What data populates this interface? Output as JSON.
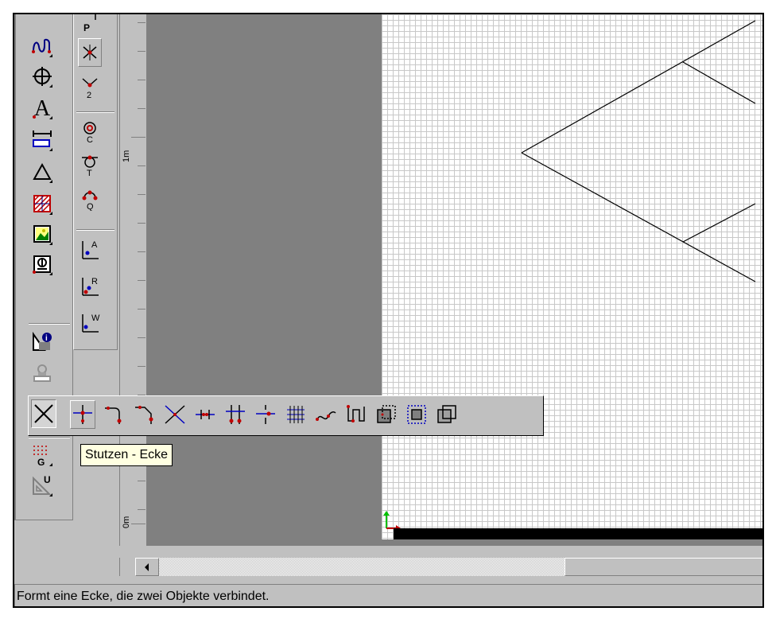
{
  "ruler": {
    "label_top": "1m",
    "label_bottom": "0m"
  },
  "palette_main": {
    "tools": [
      {
        "icon": "curve-tool-icon"
      },
      {
        "icon": "crosshair-circle-icon"
      },
      {
        "icon": "text-tool-icon",
        "glyph": "A"
      },
      {
        "icon": "dimension-tool-icon"
      },
      {
        "icon": "triangle-tool-icon"
      },
      {
        "icon": "hatch-tool-icon"
      },
      {
        "icon": "image-tool-icon"
      },
      {
        "icon": "symbol-tool-icon"
      },
      {
        "icon": "object-info-icon"
      },
      {
        "icon": "stamp-tool-icon"
      },
      {
        "icon": "cut-corner-tool-icon"
      },
      {
        "icon": "grid-tool-icon",
        "letter": "G"
      },
      {
        "icon": "set-square-icon",
        "letter": "U"
      }
    ]
  },
  "palette_snap": {
    "tools": [
      {
        "icon": "snap-point-icon",
        "letter": "P"
      },
      {
        "icon": "snap-intersection-icon"
      },
      {
        "icon": "snap-2-icon",
        "letter": "2"
      },
      {
        "icon": "snap-center-icon",
        "letter": "C"
      },
      {
        "icon": "snap-tangent-icon",
        "letter": "T"
      },
      {
        "icon": "snap-quadrant-icon",
        "letter": "Q"
      },
      {
        "icon": "axis-a-icon",
        "letter": "A"
      },
      {
        "icon": "axis-r-icon",
        "letter": "R"
      },
      {
        "icon": "axis-w-icon",
        "letter": "W"
      }
    ]
  },
  "flyout_toolbar": {
    "tools": [
      {
        "name": "trim-corner"
      },
      {
        "name": "corner-join"
      },
      {
        "name": "fillet-corner"
      },
      {
        "name": "chamfer-corner"
      },
      {
        "name": "cross-intersect"
      },
      {
        "name": "split-points"
      },
      {
        "name": "split-segments"
      },
      {
        "name": "break-line"
      },
      {
        "name": "grid-divide"
      },
      {
        "name": "curve-connect"
      },
      {
        "name": "bracket-shape"
      },
      {
        "name": "offset-shape"
      },
      {
        "name": "inner-shape"
      },
      {
        "name": "outer-shape"
      }
    ]
  },
  "tooltip": {
    "text": "Stutzen - Ecke"
  },
  "statusbar": {
    "text": "Formt eine Ecke, die zwei Objekte verbindet."
  },
  "colors": {
    "face": "#c0c0c0",
    "shadow": "#808080",
    "tooltip_bg": "#ffffe1",
    "grid": "#c8c8c8",
    "accent_red": "#c00000",
    "accent_blue": "#0000c0",
    "origin_green": "#00c000"
  }
}
